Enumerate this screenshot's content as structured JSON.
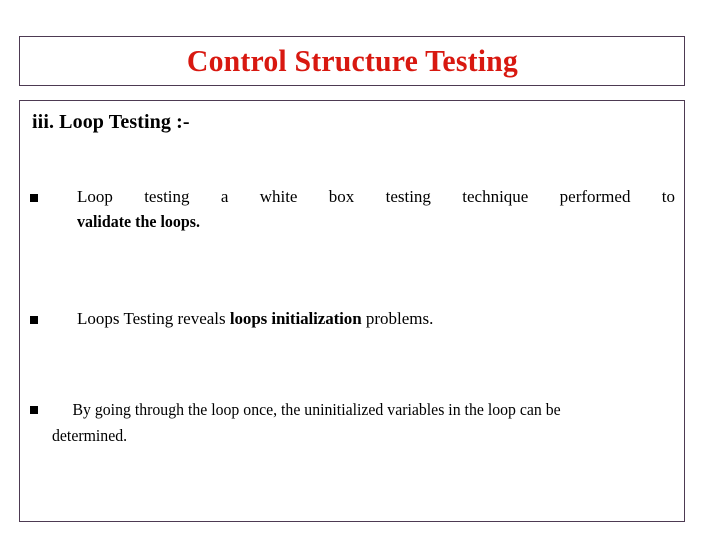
{
  "slide": {
    "title": "Control Structure Testing",
    "title_color": "#d81810",
    "border_color": "#4d3a52",
    "background_color": "#ffffff",
    "text_color": "#000000"
  },
  "content": {
    "subheading": "iii.  Loop Testing :-",
    "bullet_glyph": "square-bullet",
    "bullets": [
      {
        "id": "bullet-1",
        "lead_text": "Loop testing a white box testing technique performed to",
        "bold_text": "validate the loops.",
        "full_text": "Loop testing a white box testing technique performed to validate the loops."
      },
      {
        "id": "bullet-2",
        "prefix_text": "Loops Testing reveals ",
        "bold_text": "loops initialization",
        "suffix_text": " problems.",
        "full_text": "Loops Testing reveals loops initialization problems."
      },
      {
        "id": "bullet-3",
        "full_text": "By going through the loop once, the uninitialized variables in the loop can be determined."
      }
    ]
  }
}
